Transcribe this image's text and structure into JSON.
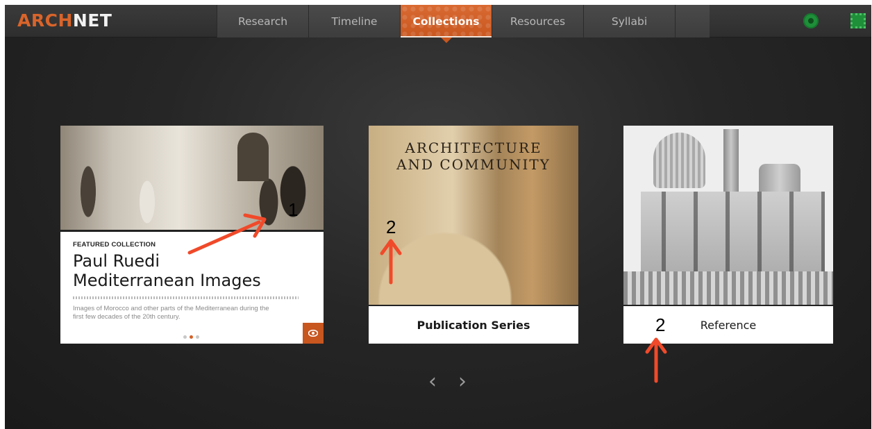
{
  "header": {
    "logo_part1": "ARCH",
    "logo_part2": "NET",
    "nav": [
      {
        "label": "Research"
      },
      {
        "label": "Timeline"
      },
      {
        "label": "Collections",
        "active": true
      },
      {
        "label": "Resources"
      },
      {
        "label": "Syllabi"
      }
    ],
    "icons": [
      "flower-icon",
      "square-pattern-icon"
    ]
  },
  "featured": {
    "kicker": "FEATURED COLLECTION",
    "title_line1": "Paul Ruedi",
    "title_line2": "Mediterranean Images",
    "description": "Images of Morocco and other parts of the Mediterranean during the first few decades of the 20th century.",
    "dots_count": 3,
    "active_dot": 2
  },
  "publication": {
    "cover_line1": "ARCHITECTURE",
    "cover_line2": "AND COMMUNITY",
    "label": "Publication Series"
  },
  "reference": {
    "label": "Reference"
  },
  "annotations": {
    "num_1": "1",
    "num_2a": "2",
    "num_2b": "2"
  },
  "carousel": {
    "prev": "‹",
    "next": "›"
  },
  "colors": {
    "accent": "#d4612a",
    "arrow": "#f04a2a",
    "background": "#262626"
  }
}
